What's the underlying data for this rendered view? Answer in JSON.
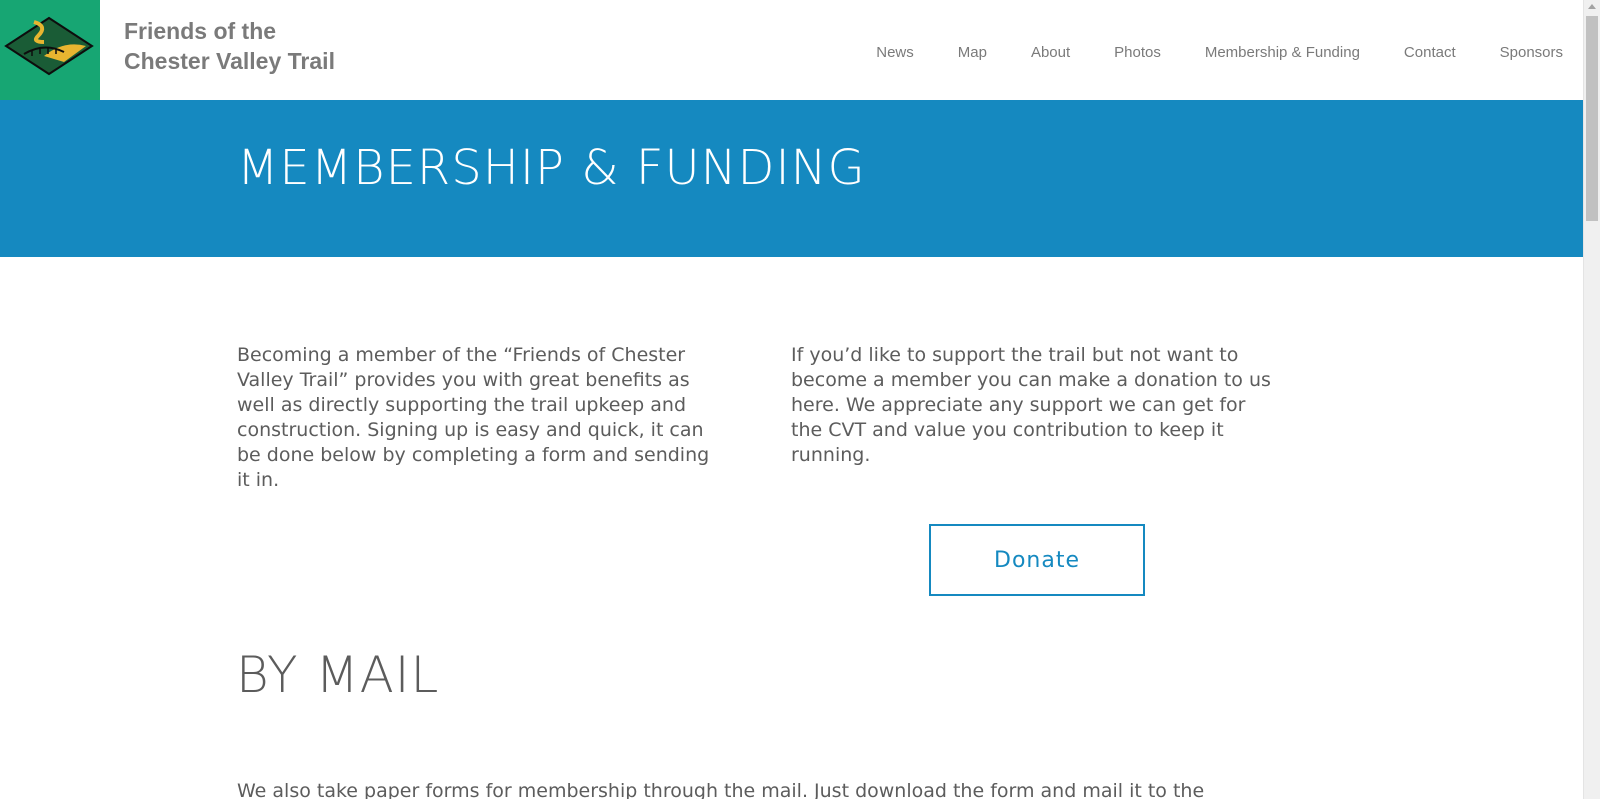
{
  "header": {
    "logo_icon": "trail-logo-icon",
    "site_title_line1": "Friends of the",
    "site_title_line2": "Chester Valley Trail",
    "nav": [
      "News",
      "Map",
      "About",
      "Photos",
      "Membership & Funding",
      "Contact",
      "Sponsors"
    ]
  },
  "banner": {
    "title": "MEMBERSHIP & FUNDING",
    "background_color": "#1589c0"
  },
  "content": {
    "left_text": "Becoming a member of the “Friends of Chester Valley Trail” provides you with great benefits as well as directly supporting the trail upkeep and construction. Signing up is easy and quick, it can be done below by completing a form and sending it in.",
    "right_text": "If you’d like to support the trail but not want to become a member you can make a donation to us here. We appreciate any support we can get for the CVT and value you contribution to keep it running.",
    "donate_label": "Donate",
    "by_mail_title": "BY MAIL",
    "by_mail_text": "We also take paper forms for membership through the mail. Just download the form and mail it to the"
  },
  "colors": {
    "accent": "#1589c0",
    "logo_bg": "#17a673",
    "text": "#5c5c5c",
    "nav_text": "#7a7a7a"
  }
}
